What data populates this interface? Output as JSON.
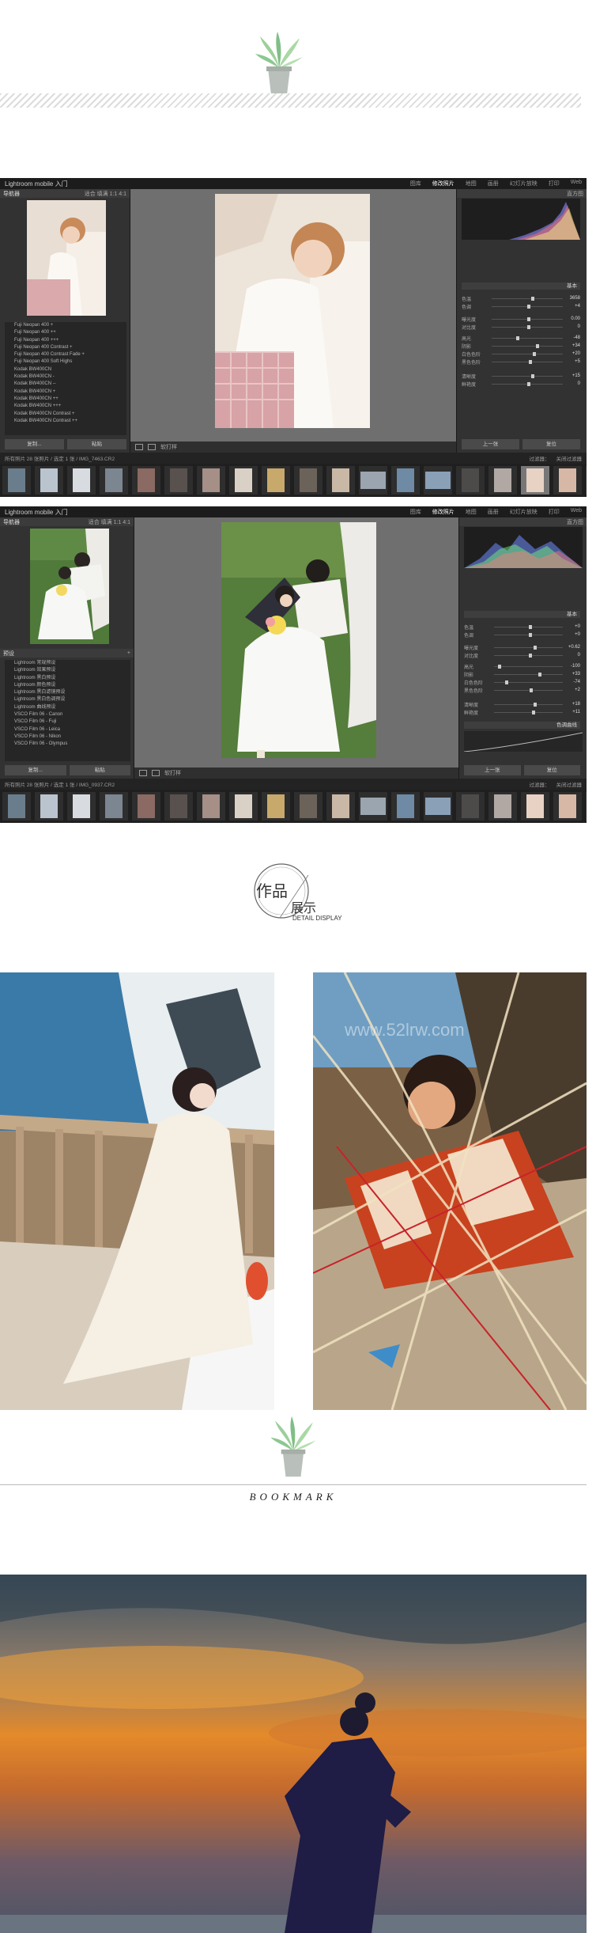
{
  "lr1": {
    "title": "Lightroom mobile 入门",
    "menus": [
      "图库",
      "修改照片",
      "地图",
      "画册",
      "幻灯片放映",
      "打印",
      "Web"
    ],
    "active_menu": "修改照片",
    "left_header": "导航器",
    "left_header_right": "适合  填满  1:1  4:1",
    "presets": [
      "Fuji Neopan 400 +",
      "Fuji Neopan 400 ++",
      "Fuji Neopan 400 +++",
      "Fuji Neopan 400 Contrast +",
      "Fuji Neopan 400 Contrast Fade +",
      "Fuji Neopan 400 Soft Highs",
      "Kodak BW400CN",
      "Kodak BW400CN -",
      "Kodak BW400CN --",
      "Kodak BW400CN +",
      "Kodak BW400CN ++",
      "Kodak BW400CN +++",
      "Kodak BW400CN Contrast +",
      "Kodak BW400CN Contrast ++"
    ],
    "left_buttons": [
      "复制...",
      "粘贴"
    ],
    "right_header": "直方图",
    "basic_label": "基本",
    "right_rows": [
      {
        "label": "色温",
        "value": "3658"
      },
      {
        "label": "色调",
        "value": "+4"
      },
      {
        "label": "曝光度",
        "value": "0.00"
      },
      {
        "label": "对比度",
        "value": "0"
      },
      {
        "label": "高光",
        "value": "-48"
      },
      {
        "label": "阴影",
        "value": "+34"
      },
      {
        "label": "白色色阶",
        "value": "+20"
      },
      {
        "label": "黑色色阶",
        "value": "+5"
      },
      {
        "label": "清晰度",
        "value": "+15"
      },
      {
        "label": "鲜艳度",
        "value": "0"
      }
    ],
    "right_buttons": [
      "上一张",
      "复位"
    ],
    "toolbar_text": "软打样",
    "film_info": "所有照片  28 张照片 / 选定 1 张 / IMG_7463.CR2",
    "film_right": "过滤器：",
    "film_right2": "关闭过滤器"
  },
  "lr2": {
    "title": "Lightroom mobile 入门",
    "menus": [
      "图库",
      "修改照片",
      "地图",
      "画册",
      "幻灯片放映",
      "打印",
      "Web"
    ],
    "active_menu": "修改照片",
    "left_header": "导航器",
    "left_header_right": "适合  填满  1:1  4:1",
    "preset_header": "预设",
    "presets": [
      "Lightroom 常规预设",
      "Lightroom 效果预设",
      "Lightroom 黑白预设",
      "Lightroom 颜色预设",
      "Lightroom 黑白滤镜预设",
      "Lightroom 黑白色调预设",
      "Lightroom 曲线预设",
      "VSCO Film 06 - Canon",
      "VSCO Film 06 - Fuji",
      "VSCO Film 06 - Leica",
      "VSCO Film 06 - Nikon",
      "VSCO Film 06 - Olympus"
    ],
    "left_buttons": [
      "复制...",
      "粘贴"
    ],
    "right_header": "直方图",
    "basic_label": "基本",
    "right_rows": [
      {
        "label": "色温",
        "value": "+0"
      },
      {
        "label": "色调",
        "value": "+0"
      },
      {
        "label": "曝光度",
        "value": "+0.62"
      },
      {
        "label": "对比度",
        "value": "0"
      },
      {
        "label": "高光",
        "value": "-100"
      },
      {
        "label": "阴影",
        "value": "+33"
      },
      {
        "label": "白色色阶",
        "value": "-74"
      },
      {
        "label": "黑色色阶",
        "value": "+2"
      },
      {
        "label": "清晰度",
        "value": "+18"
      },
      {
        "label": "鲜艳度",
        "value": "+11"
      }
    ],
    "curve_label": "色调曲线",
    "right_buttons": [
      "上一张",
      "复位"
    ],
    "toolbar_text": "软打样",
    "film_info": "所有照片  28 张照片 / 选定 1 张 / IMG_0937.CR2",
    "film_right": "过滤器：",
    "film_right2": "关闭过滤器"
  },
  "section": {
    "cn1": "作品",
    "cn2": "展示",
    "en": "DETAIL DISPLAY"
  },
  "watermark": "www.52lrw.com",
  "bookmark": "BOOKMARK"
}
